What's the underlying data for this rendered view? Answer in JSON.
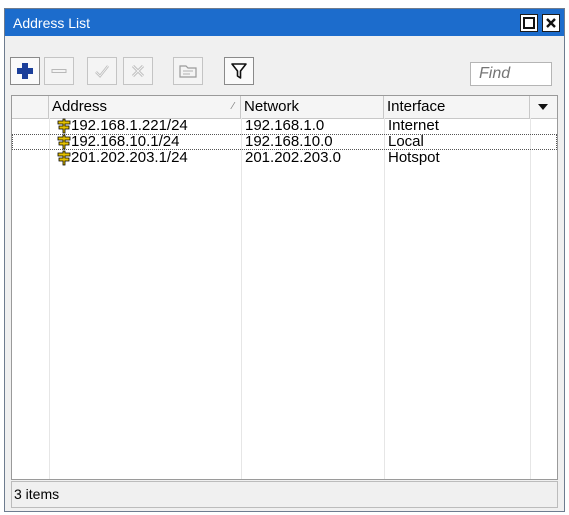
{
  "window": {
    "title": "Address List"
  },
  "toolbar": {
    "buttons": [
      "add-icon",
      "remove-icon",
      "enable-icon",
      "disable-icon",
      "comment-icon",
      "filter-icon"
    ],
    "find_placeholder": "Find"
  },
  "table": {
    "columns": [
      "Address",
      "Network",
      "Interface"
    ],
    "rows": [
      {
        "address": "192.168.1.221/24",
        "network": "192.168.1.0",
        "interface": "Internet"
      },
      {
        "address": "192.168.10.1/24",
        "network": "192.168.10.0",
        "interface": "Local"
      },
      {
        "address": "201.202.203.1/24",
        "network": "201.202.203.0",
        "interface": "Hotspot"
      }
    ]
  },
  "status": {
    "count_text": "3 items"
  },
  "colors": {
    "titlebar": "#1c6ccc",
    "add_icon": "#1b3f9a",
    "address_icon": "#e6c200"
  }
}
